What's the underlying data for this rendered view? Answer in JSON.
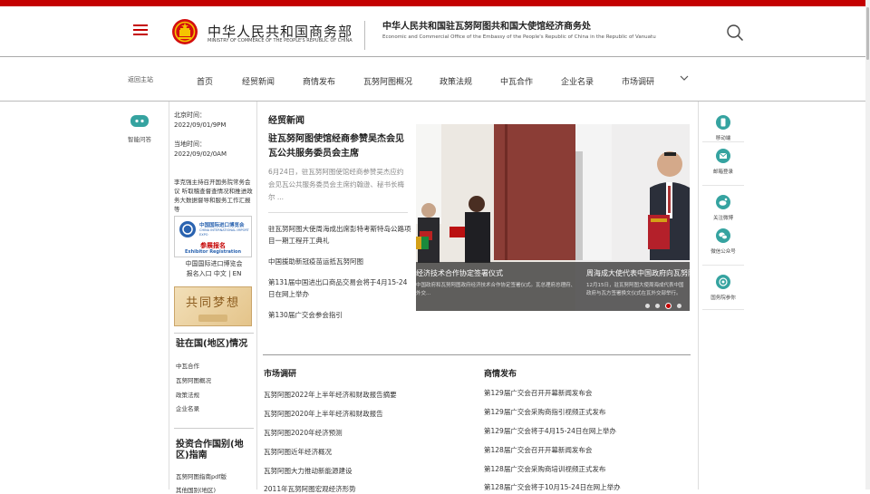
{
  "colors": {
    "accent": "#c40000",
    "icon": "#35a3a0"
  },
  "header": {
    "ministry_cn": "中华人民共和国商务部",
    "ministry_en": "MINISTRY OF COMMERCE OF THE PEOPLE'S REPUBLIC OF CHINA",
    "office_cn": "中华人民共和国驻瓦努阿图共和国大使馆经济商务处",
    "office_en": "Economic and Commercial Office of the Embassy of the People's Republic of China in the Republic of Vanuatu",
    "icons": {
      "menu": "hamburger-menu-icon",
      "emblem": "national-emblem-icon",
      "search": "search-icon"
    }
  },
  "nav": {
    "back": "返回主站",
    "items": [
      "首页",
      "经贸新闻",
      "商情发布",
      "瓦努阿图概况",
      "政策法规",
      "中瓦合作",
      "企业名录",
      "市场调研"
    ],
    "more_icon": "chevron-down-icon"
  },
  "left_rail": {
    "assistant_label": "智能问答",
    "icon": "chat-bot-icon"
  },
  "sidebar": {
    "beijing_time_label": "北京时间：",
    "beijing_time": "2022/09/01/9PM",
    "local_time_label": "当地时间：",
    "local_time": "2022/09/02/0AM",
    "speech": "李克强主持召开国务院常务会议 听取稽查督查情况和推进政务大数据督导和服务工作汇报等",
    "expo": {
      "title_cn": "中国国际进口博览会",
      "title_en": "CHINA INTERNATIONAL IMPORT EXPO",
      "badge": "参展报名",
      "badge_en": "Exhibitor Registration",
      "caption_line1": "中国国际进口博览会",
      "caption_line2": "报名入口 中文 | EN"
    },
    "dream_banner": "共同梦想",
    "country_heading": "驻在国(地区)情况",
    "country_links": [
      "中瓦合作",
      "瓦努阿图概况",
      "政策法规",
      "企业名录"
    ],
    "guide_heading": "投资合作国别(地区)指南",
    "guide_links": [
      "瓦努阿图指南pdf版",
      "其他国别(地区)"
    ]
  },
  "main": {
    "news_title": "经贸新闻",
    "featured_title": "驻瓦努阿图使馆经商参赞吴杰会见瓦公共服务委员会主席",
    "featured_summary": "6月24日，驻瓦努阿图使馆经商参赞吴杰应约会见瓦公共服务委员会主席约翰逊、秘书长梅尔 ...",
    "news_items": [
      "驻瓦努阿图大使周海成出席彭特考斯特岛公路项目一期工程开工典礼",
      "中国援助新冠疫苗运抵瓦努阿图",
      "第131届中国进出口商品交易会将于4月15-24日在网上举办",
      "第130届广交会参会指引"
    ],
    "slides": [
      {
        "title": "经济技术合作协定签署仪式",
        "desc": "中国政府和瓦努阿图政府经济技术合作协定签署仪式。瓦总理府总理府、外交..."
      },
      {
        "title": "周海成大使代表中国政府向瓦努阿图",
        "desc": "12月15日，驻瓦努阿图大使周海成代表中国政府与瓦方签署换文仪式在瓦外交部举行。"
      }
    ],
    "slide_count": 4,
    "slide_active": 3,
    "market_title": "市场调研",
    "market_links": [
      "瓦努阿图2022年上半年经济和财政报告摘要",
      "瓦努阿图2020年上半年经济和财政报告",
      "瓦努阿图2020年经济预测",
      "瓦努阿图近年经济概况",
      "瓦努阿图大力推动新能源建设",
      "2011年瓦努阿图宏观经济形势"
    ],
    "trade_title": "商情发布",
    "trade_links": [
      "第129届广交会召开开幕新闻发布会",
      "第129届广交会采购商指引视频正式发布",
      "第129届广交会将于4月15-24日在网上举办",
      "第128届广交会召开开幕新闻发布会",
      "第128届广交会采购商培训视频正式发布",
      "第128届广交会将于10月15-24日在网上举办"
    ]
  },
  "right_rail": {
    "items": [
      {
        "label": "移动端",
        "icon": "mobile-icon"
      },
      {
        "label": "邮箱登录",
        "icon": "mail-icon"
      },
      {
        "label": "关注微博",
        "icon": "weibo-icon"
      },
      {
        "label": "微信公众号",
        "icon": "wechat-icon"
      },
      {
        "label": "国务院参你",
        "icon": "at-sign-icon"
      }
    ]
  }
}
